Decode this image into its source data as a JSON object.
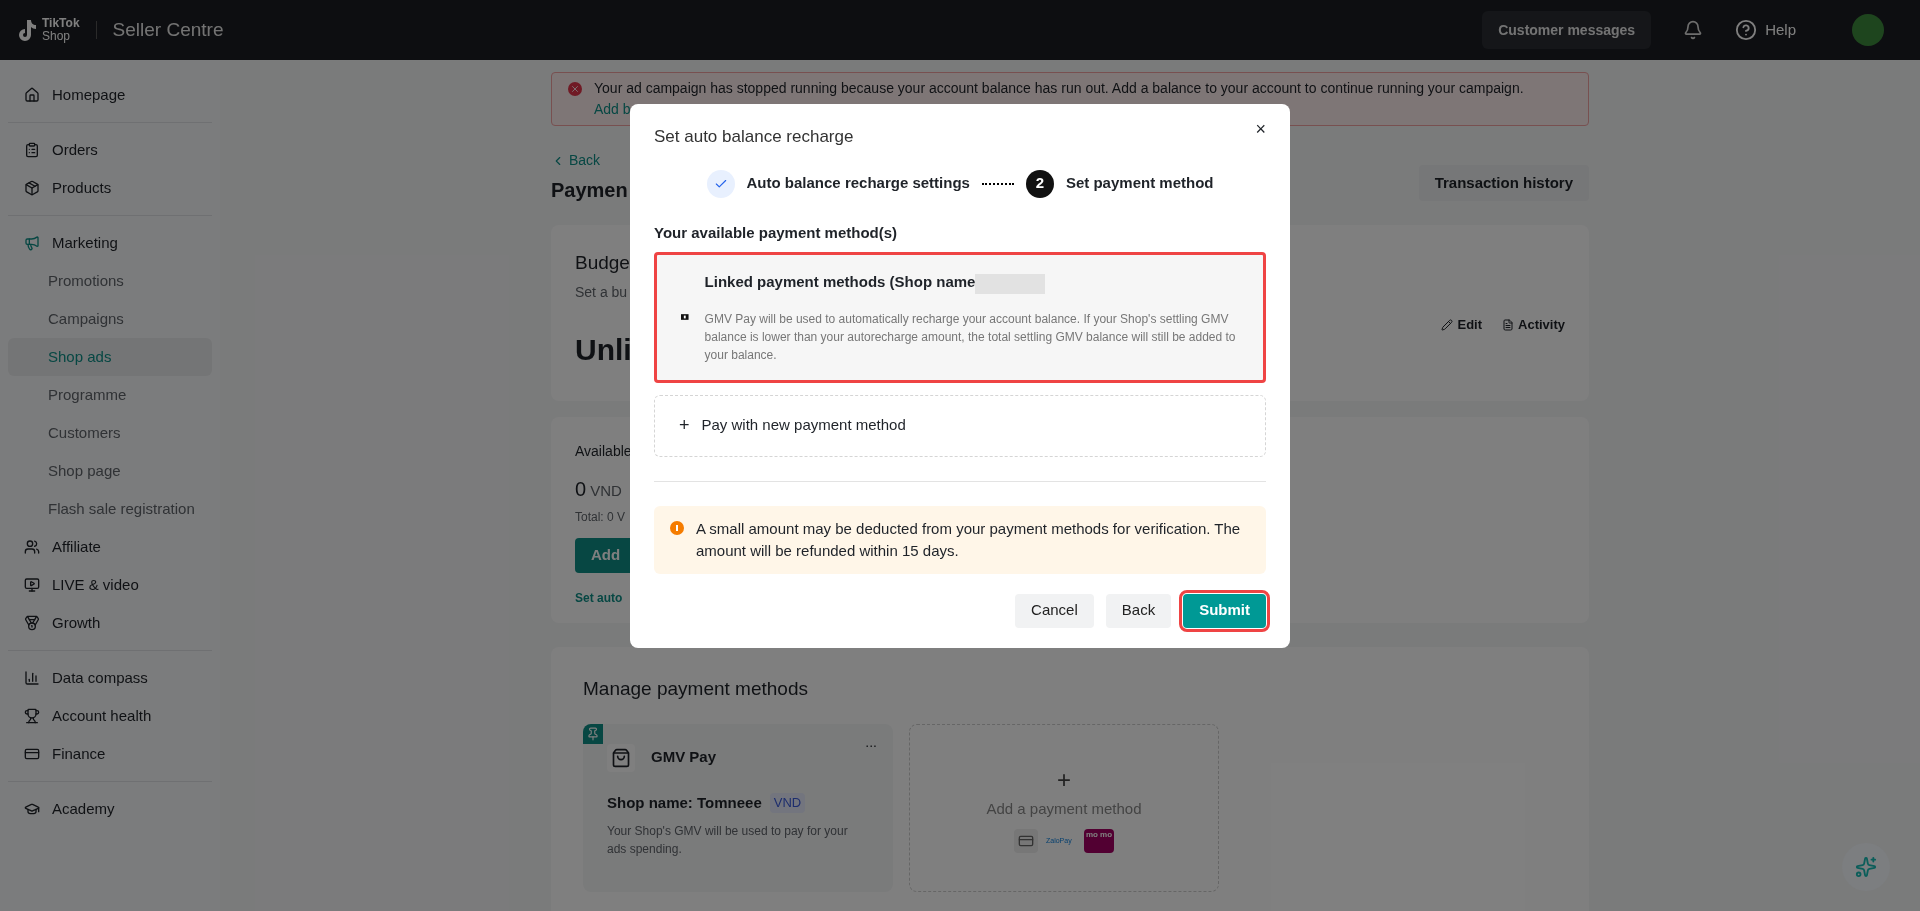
{
  "header": {
    "logo_top": "TikTok",
    "logo_bottom": "Shop",
    "product": "Seller Centre",
    "messages_button": "Customer messages",
    "help": "Help"
  },
  "sidebar": {
    "groups": [
      [
        {
          "label": "Homepage",
          "selected": false
        }
      ],
      [
        {
          "label": "Orders",
          "selected": false
        },
        {
          "label": "Products",
          "selected": false
        }
      ],
      [
        {
          "label": "Marketing",
          "selected": false,
          "children": [
            {
              "label": "Promotions",
              "selected": false
            },
            {
              "label": "Campaigns",
              "selected": false
            },
            {
              "label": "Shop ads",
              "selected": true
            },
            {
              "label": "Programme",
              "selected": false
            },
            {
              "label": "Customers",
              "selected": false
            },
            {
              "label": "Shop page",
              "selected": false
            },
            {
              "label": "Flash sale registration",
              "selected": false
            }
          ]
        },
        {
          "label": "Affiliate",
          "selected": false
        },
        {
          "label": "LIVE & video",
          "selected": false
        },
        {
          "label": "Growth",
          "selected": false
        }
      ],
      [
        {
          "label": "Data compass",
          "selected": false
        },
        {
          "label": "Account health",
          "selected": false
        },
        {
          "label": "Finance",
          "selected": false
        }
      ],
      [
        {
          "label": "Academy",
          "selected": false
        }
      ]
    ]
  },
  "banner": {
    "message": "Your ad campaign has stopped running because your account balance has run out. Add a balance to your account to continue running your campaign.",
    "link": "Add b"
  },
  "page": {
    "back": "Back",
    "title": "Paymen",
    "transaction_button": "Transaction history"
  },
  "budget_card": {
    "title": "Budge",
    "subtitle": "Set a bu",
    "value": "Unli",
    "edit": "Edit",
    "activity": "Activity"
  },
  "balance_card": {
    "label": "Available",
    "amount": "0",
    "currency": "VND",
    "total": "Total: 0 V",
    "add_button": "Add",
    "auto_link": "Set auto"
  },
  "manage": {
    "title": "Manage payment methods",
    "method": {
      "name": "GMV Pay",
      "shop_label": "Shop name: Tomneee",
      "currency_tag": "VND",
      "menu": "...",
      "description": "Your Shop's GMV will be used to pay for your ads spending."
    },
    "add": {
      "plus": "+",
      "label": "Add a payment method",
      "logos": [
        {
          "kind": "card"
        },
        {
          "kind": "zalo",
          "text": "ZaloPay"
        },
        {
          "kind": "momo",
          "text": "mo mo"
        }
      ]
    }
  },
  "modal": {
    "title": "Set auto balance recharge",
    "close": "×",
    "steps": [
      {
        "label": "Auto balance recharge settings",
        "done": true
      },
      {
        "label": "Set payment method",
        "done": false,
        "number": "2"
      }
    ],
    "section_label": "Your available payment method(s)",
    "options": [
      {
        "kind": "linked",
        "title": "Linked payment methods (Shop name",
        "redacted": true,
        "description": "GMV Pay will be used to automatically recharge your account balance. If your Shop's settling GMV balance is lower than your autorecharge amount, the total settling GMV balance will still be added to your balance.",
        "selected": true
      },
      {
        "kind": "new",
        "plus": "+",
        "title": "Pay with new payment method",
        "selected": false
      }
    ],
    "alert": "A small amount may be deducted from your payment methods for verification. The amount will be refunded within 15 days.",
    "buttons": [
      {
        "label": "Cancel",
        "kind": "secondary",
        "highlighted": false
      },
      {
        "label": "Back",
        "kind": "secondary",
        "highlighted": false
      },
      {
        "label": "Submit",
        "kind": "primary",
        "highlighted": true
      }
    ]
  }
}
